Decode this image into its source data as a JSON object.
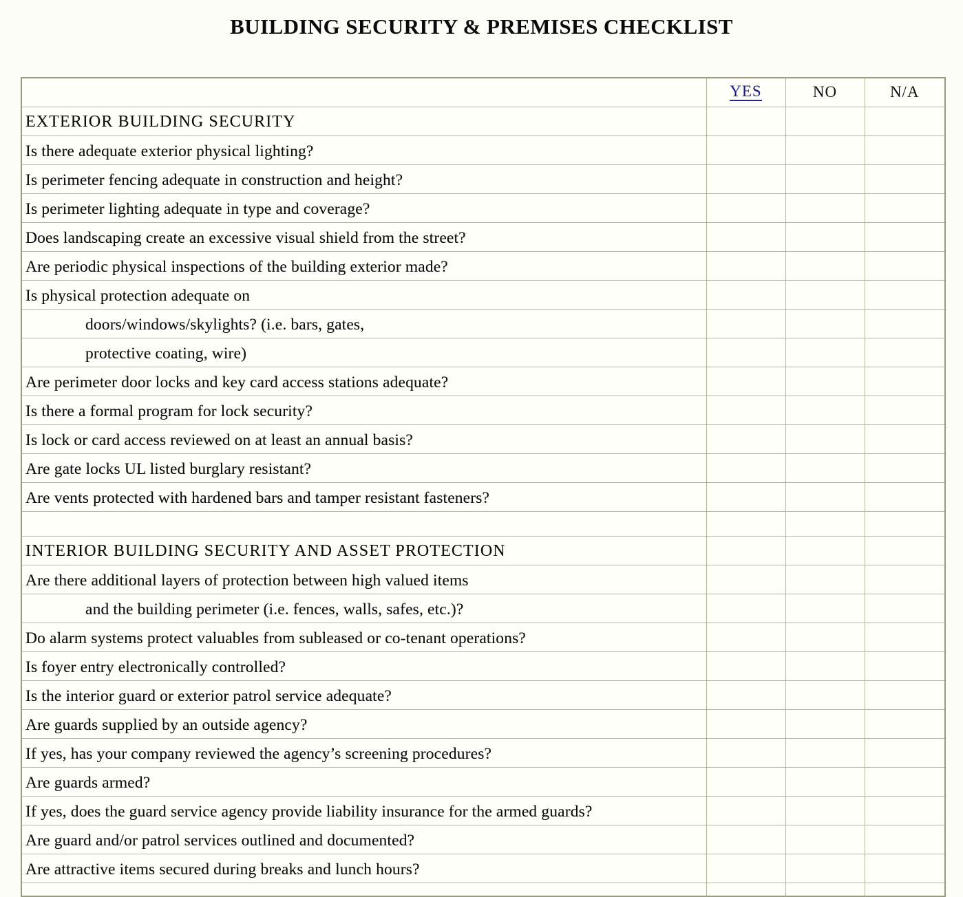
{
  "document": {
    "title": "BUILDING SECURITY & PREMISES CHECKLIST"
  },
  "table": {
    "columns": [
      {
        "key": "item",
        "label": ""
      },
      {
        "key": "yes",
        "label": "YES"
      },
      {
        "key": "no",
        "label": "NO"
      },
      {
        "key": "na",
        "label": "N/A"
      }
    ],
    "column_header_yes": "YES",
    "column_header_no": "NO",
    "column_header_na": "N/A",
    "accent_link_color": "#16168c",
    "border_color": "#b5b49a",
    "frame_color": "#9b9a80",
    "background_color": "#fffffa",
    "rows": [
      {
        "type": "section",
        "text": "EXTERIOR BUILDING SECURITY",
        "yes": "",
        "no": "",
        "na": ""
      },
      {
        "type": "item",
        "text": "Is there  adequate  exterior physical lighting?",
        "yes": "",
        "no": "",
        "na": ""
      },
      {
        "type": "item",
        "text": "Is perimeter  fencing adequate  in construction  and height?",
        "yes": "",
        "no": "",
        "na": ""
      },
      {
        "type": "item",
        "text": "Is perimeter  lighting adequate  in type  and coverage?",
        "yes": "",
        "no": "",
        "na": ""
      },
      {
        "type": "item",
        "text": "Does landscaping  create  an excessive  visual shield from  the  street?",
        "yes": "",
        "no": "",
        "na": ""
      },
      {
        "type": "item",
        "text": "Are periodic physical inspections  of the building  exterior  made?",
        "yes": "",
        "no": "",
        "na": ""
      },
      {
        "type": "item",
        "text": "Is physical protection  adequate  on",
        "yes": "",
        "no": "",
        "na": ""
      },
      {
        "type": "item-indent",
        "text": "doors/windows/skylights?  (i.e. bars, gates,",
        "yes": "",
        "no": "",
        "na": ""
      },
      {
        "type": "item-indent",
        "text": "protective  coating, wire)",
        "yes": "",
        "no": "",
        "na": ""
      },
      {
        "type": "item",
        "text": "Are perimeter  door locks and key card access stations  adequate?",
        "yes": "",
        "no": "",
        "na": ""
      },
      {
        "type": "item",
        "text": "Is there  a formal program  for lock security?",
        "yes": "",
        "no": "",
        "na": ""
      },
      {
        "type": "item",
        "text": "Is lock or card access reviewed  on at least an  annual  basis?",
        "yes": "",
        "no": "",
        "na": ""
      },
      {
        "type": "item",
        "text": "Are gate  locks UL listed burglary resistant?",
        "yes": "",
        "no": "",
        "na": ""
      },
      {
        "type": "item",
        "text": "Are vents protected  with hardened  bars and tamper  resistant  fasteners?",
        "yes": "",
        "no": "",
        "na": ""
      },
      {
        "type": "spacer",
        "text": "",
        "yes": "",
        "no": "",
        "na": ""
      },
      {
        "type": "section",
        "text": "INTERIOR BUILDING SECURITY AND ASSET PROTECTION",
        "yes": "",
        "no": "",
        "na": ""
      },
      {
        "type": "item",
        "text": "Are there  additional  layers  of protection  between  high valued items",
        "yes": "",
        "no": "",
        "na": ""
      },
      {
        "type": "item-indent",
        "text": "and the building perimeter  (i.e. fences, walls, safes, etc.)?",
        "yes": "",
        "no": "",
        "na": ""
      },
      {
        "type": "item",
        "text": "Do alarm systems protect valuables from subleased  or co-tenant  operations?",
        "yes": "",
        "no": "",
        "na": ""
      },
      {
        "type": "item",
        "text": "Is foyer entry electronically  controlled?",
        "yes": "",
        "no": "",
        "na": ""
      },
      {
        "type": "item",
        "text": "Is the interior  guard  or exterior  patrol  service adequate?",
        "yes": "",
        "no": "",
        "na": ""
      },
      {
        "type": "item",
        "text": "Are guards  supplied by an outside  agency?",
        "yes": "",
        "no": "",
        "na": ""
      },
      {
        "type": "item",
        "text": "If yes, has your company reviewed  the  agency’s  screening  procedures?",
        "yes": "",
        "no": "",
        "na": ""
      },
      {
        "type": "item",
        "text": "Are guards  armed?",
        "yes": "",
        "no": "",
        "na": ""
      },
      {
        "type": "item",
        "text": "If yes, does the  guard  service agency provide liability insurance  for the  armed  guards?",
        "yes": "",
        "no": "",
        "na": ""
      },
      {
        "type": "item",
        "text": "Are guard  and/or  patrol  services outlined  and documented?",
        "yes": "",
        "no": "",
        "na": ""
      },
      {
        "type": "item",
        "text": "Are attractive  items secured  during  breaks and lunch hours?",
        "yes": "",
        "no": "",
        "na": ""
      },
      {
        "type": "cut",
        "text": "",
        "yes": "",
        "no": "",
        "na": ""
      }
    ]
  }
}
